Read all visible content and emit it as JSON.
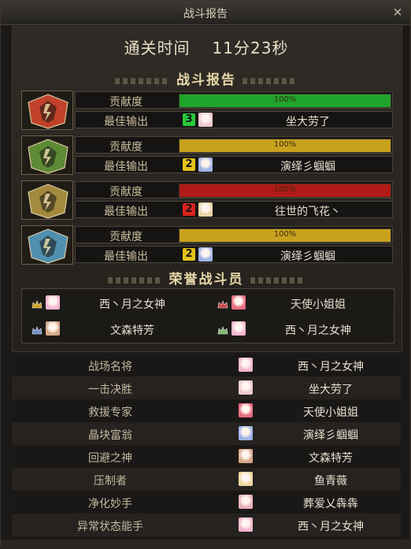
{
  "window": {
    "title": "战斗报告",
    "close_glyph": "×"
  },
  "clear_time": {
    "label": "通关时间",
    "value": "11分23秒"
  },
  "report_heading": "战斗报告",
  "bosses": [
    {
      "portrait": "red-boss-icon",
      "color": "#c0412a",
      "contribution_label": "贡献度",
      "contribution_pct": 100,
      "contribution_text": "100%",
      "bar_color": "#1fa52b",
      "best_label": "最佳输出",
      "rank": "3",
      "rank_color": "#27c93a",
      "avatar_color": "#f0c8d0",
      "player": "坐大劳了"
    },
    {
      "portrait": "green-boss-icon",
      "color": "#5e8a36",
      "contribution_label": "贡献度",
      "contribution_pct": 100,
      "contribution_text": "100%",
      "bar_color": "#c9a21e",
      "best_label": "最佳输出",
      "rank": "2",
      "rank_color": "#e3c21a",
      "avatar_color": "#9fb3e6",
      "player": "演绎彡蝈蝈"
    },
    {
      "portrait": "gold-boss-icon",
      "color": "#a38a3e",
      "contribution_label": "贡献度",
      "contribution_pct": 100,
      "contribution_text": "100%",
      "bar_color": "#b11a16",
      "best_label": "最佳输出",
      "rank": "2",
      "rank_color": "#d82420",
      "avatar_color": "#e9d2a8",
      "player": "往世的飞花丶"
    },
    {
      "portrait": "blue-boss-icon",
      "color": "#4f8fb0",
      "contribution_label": "贡献度",
      "contribution_pct": 100,
      "contribution_text": "100%",
      "bar_color": "#c9a21e",
      "best_label": "最佳输出",
      "rank": "2",
      "rank_color": "#e3c21a",
      "avatar_color": "#9fb3e6",
      "player": "演绎彡蝈蝈"
    }
  ],
  "honor_heading": "荣誉战斗员",
  "honor": [
    {
      "icon": "gold-crown-icon",
      "icon_color": "#c9a21e",
      "avatar_color": "#f2b7cf",
      "name": "西丶月之女神"
    },
    {
      "icon": "red-crown-icon",
      "icon_color": "#c7473f",
      "avatar_color": "#e66b80",
      "name": "天使小姐姐"
    },
    {
      "icon": "blue-crown-icon",
      "icon_color": "#6d8fc9",
      "avatar_color": "#d7a88a",
      "name": "文森特芳"
    },
    {
      "icon": "green-crown-icon",
      "icon_color": "#7fb46b",
      "avatar_color": "#f2b7cf",
      "name": "西丶月之女神"
    }
  ],
  "awards": [
    {
      "title": "战场名将",
      "avatar_color": "#f2b7cf",
      "name": "西丶月之女神"
    },
    {
      "title": "一击决胜",
      "avatar_color": "#f0c8d0",
      "name": "坐大劳了"
    },
    {
      "title": "救援专家",
      "avatar_color": "#e66b80",
      "name": "天使小姐姐"
    },
    {
      "title": "晶块富翁",
      "avatar_color": "#9fb3e6",
      "name": "演绎彡蝈蝈"
    },
    {
      "title": "回避之神",
      "avatar_color": "#d7a88a",
      "name": "文森特芳"
    },
    {
      "title": "压制者",
      "avatar_color": "#f3d6a0",
      "name": "鱼青薇"
    },
    {
      "title": "净化妙手",
      "avatar_color": "#e8b0b8",
      "name": "葬爱乂犇犇"
    },
    {
      "title": "异常状态能手",
      "avatar_color": "#f2b7cf",
      "name": "西丶月之女神"
    }
  ]
}
